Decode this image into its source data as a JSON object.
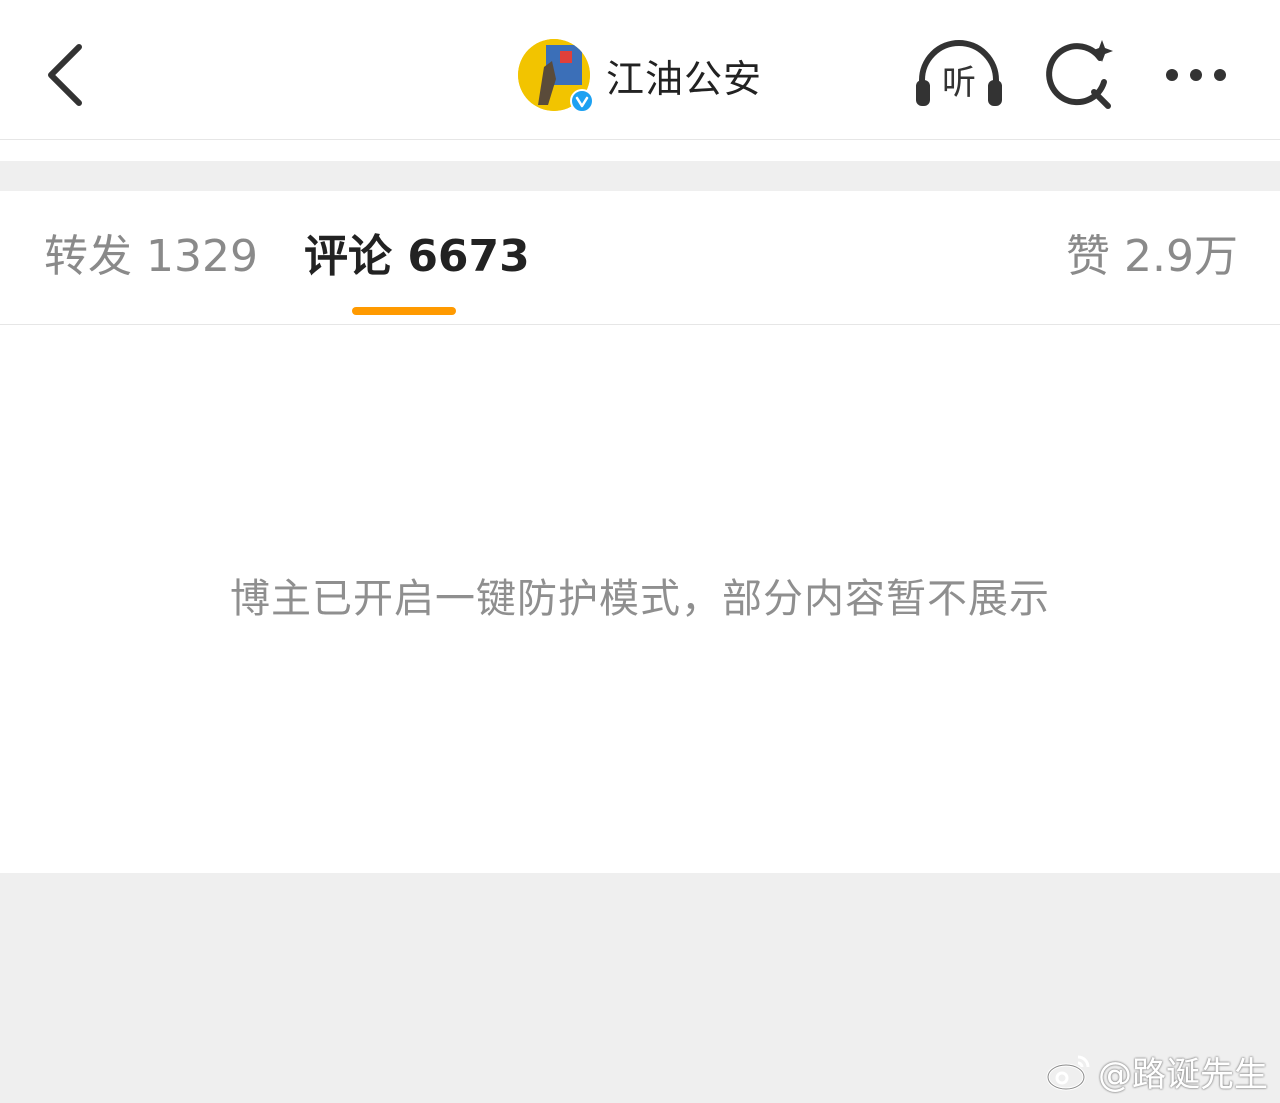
{
  "header": {
    "account_name": "江油公安",
    "listen_label": "听",
    "icons": {
      "back": "back-chevron-icon",
      "verified": "verified-badge-icon",
      "listen": "headphones-icon",
      "search": "search-sparkle-icon",
      "more": "more-dots-icon"
    }
  },
  "tabs": [
    {
      "label": "转发 1329"
    },
    {
      "label": "评论 6673",
      "active": true
    },
    {
      "label": "赞 2.9万"
    }
  ],
  "content": {
    "notice": "博主已开启一键防护模式，部分内容暂不展示"
  },
  "watermark": {
    "text": "@路诞先生"
  },
  "colors": {
    "accent": "#ff9a00",
    "verified": "#1da1f2",
    "background": "#efefef",
    "text_primary": "#222222",
    "text_secondary": "#8a8a8a"
  }
}
